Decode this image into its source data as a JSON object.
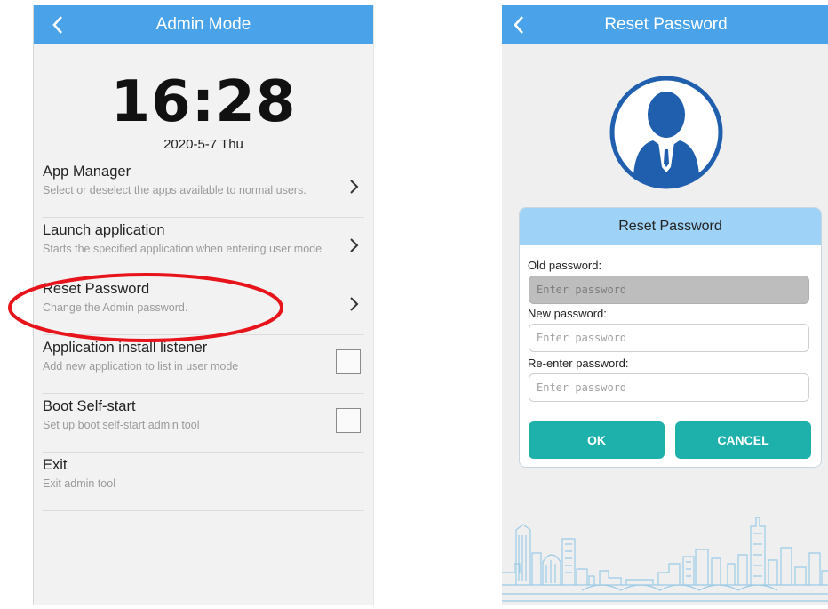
{
  "admin_screen": {
    "title": "Admin Mode",
    "clock": "16:28",
    "date": "2020-5-7 Thu",
    "menu": [
      {
        "title": "App Manager",
        "subtitle": "Select or deselect the apps available to normal users.",
        "control": "chevron"
      },
      {
        "title": "Launch application",
        "subtitle": "Starts the specified application when entering user mode",
        "control": "chevron"
      },
      {
        "title": "Reset Password",
        "subtitle": "Change the Admin password.",
        "control": "chevron",
        "highlighted": true
      },
      {
        "title": "Application install listener",
        "subtitle": "Add new application to list in user mode",
        "control": "checkbox",
        "checked": false
      },
      {
        "title": "Boot Self-start",
        "subtitle": "Set up boot self-start admin tool",
        "control": "checkbox",
        "checked": false
      },
      {
        "title": "Exit",
        "subtitle": "Exit admin tool",
        "control": "none"
      }
    ]
  },
  "reset_screen": {
    "title": "Reset Password",
    "dialog": {
      "title": "Reset Password",
      "old_label": "Old password:",
      "old_placeholder": "Enter password",
      "new_label": "New password:",
      "new_placeholder": "Enter password",
      "reenter_label": "Re-enter password:",
      "reenter_placeholder": "Enter password",
      "ok_label": "OK",
      "cancel_label": "CANCEL"
    }
  },
  "icons": {
    "back": "chevron-left-icon",
    "menu_arrow": "chevron-right-icon",
    "avatar": "user-avatar-icon",
    "skyline": "city-skyline-illustration"
  },
  "colors": {
    "app_bar": "#4aa3e8",
    "dialog_header": "#9fd2f7",
    "button": "#1eb0aa",
    "highlight": "#e8141b",
    "avatar": "#1f5fae"
  }
}
